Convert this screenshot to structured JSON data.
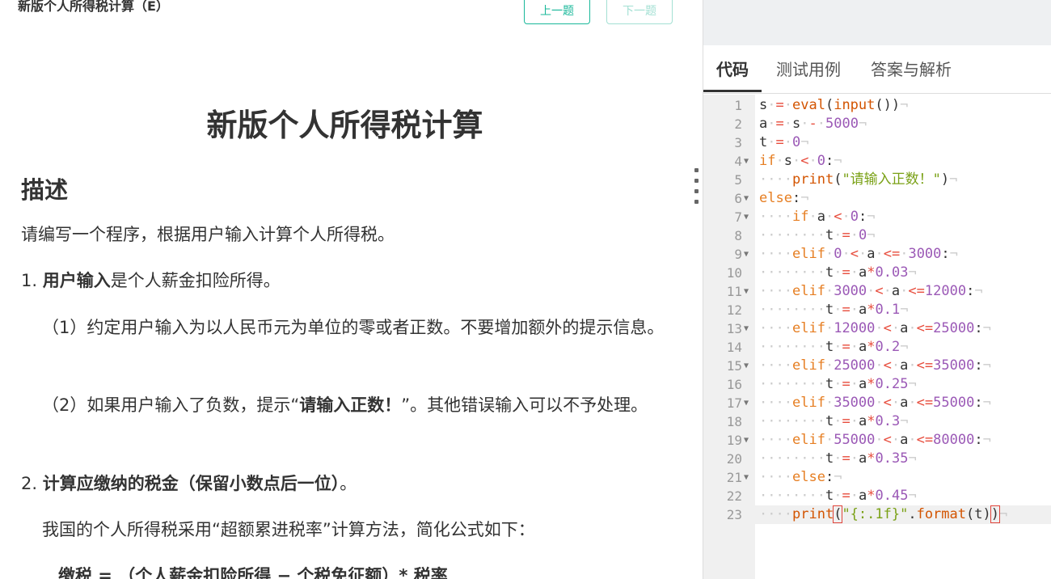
{
  "header": {
    "small_title": "新版个人所得税计算（E）",
    "prev_label": "上一题",
    "next_label": "下一题"
  },
  "problem": {
    "title": "新版个人所得税计算",
    "section": "描述",
    "intro": "请编写一个程序，根据用户输入计算个人所得税。",
    "item1_prefix": "1. ",
    "item1_bold": "用户输入",
    "item1_rest": "是个人薪金扣险所得。",
    "item1_sub1": "（1）约定用户输入为以人民币元为单位的零或者正数。不要增加额外的提示信息。",
    "item1_sub2_a": "（2）如果用户输入了负数，提示“",
    "item1_sub2_bold": "请输入正数！",
    "item1_sub2_b": "”。其他错误输入可以不予处理。",
    "item2_prefix": "2. ",
    "item2_bold": "计算应缴纳的税金（保留小数点后一位）",
    "item2_rest": "。",
    "para3": "我国的个人所得税采用“超额累进税率”计算方法，简化公式如下：",
    "formula": "缴税 = （个人薪金扣险所得 − 个税免征额）* 税率"
  },
  "tabs": {
    "code": "代码",
    "tests": "测试用例",
    "answers": "答案与解析"
  },
  "editor": {
    "active_line": 23,
    "lines": [
      "s = eval(input())",
      "a = s - 5000",
      "t = 0",
      "if s < 0:",
      "    print(\"请输入正数！\")",
      "else:",
      "    if a < 0:",
      "        t = 0",
      "    elif 0 < a <= 3000:",
      "        t = a*0.03",
      "    elif 3000 < a <=12000:",
      "        t = a*0.1",
      "    elif 12000 < a <=25000:",
      "        t = a*0.2",
      "    elif 25000 < a <=35000:",
      "        t = a*0.25",
      "    elif 35000 < a <=55000:",
      "        t = a*0.3",
      "    elif 55000 < a <=80000:",
      "        t = a*0.35",
      "    else:",
      "        t = a*0.45",
      "    print(\"{:.1f}\".format(t))"
    ],
    "fold_lines": [
      4,
      6,
      7,
      9,
      11,
      13,
      15,
      17,
      19,
      21
    ]
  }
}
